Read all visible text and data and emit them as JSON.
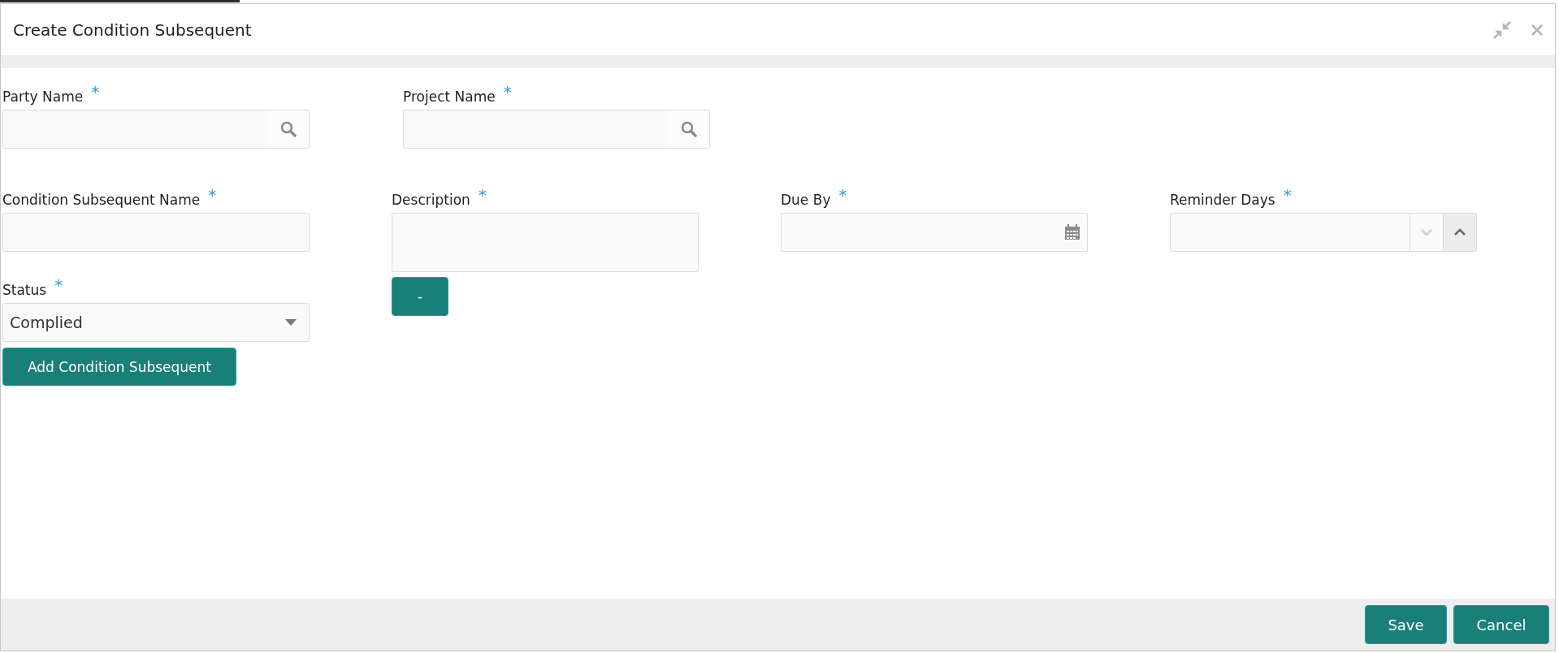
{
  "dialog": {
    "title": "Create Condition Subsequent"
  },
  "lookup_fields": [
    {
      "label": "Party Name",
      "required_mark": "*",
      "kind": "search"
    },
    {
      "label": "Project Name",
      "required_mark": "*",
      "kind": "search"
    }
  ],
  "detail_fields": [
    {
      "label": "Condition Subsequent Name",
      "required_mark": "*",
      "kind": "text"
    },
    {
      "label": "Description",
      "required_mark": "*",
      "kind": "textarea"
    },
    {
      "label": "Due By",
      "required_mark": "*",
      "kind": "date"
    },
    {
      "label": "Reminder Days",
      "required_mark": "*",
      "kind": "spinner"
    }
  ],
  "status_field": {
    "label": "Status",
    "required_mark": "*",
    "value": "Complied"
  },
  "remove_button": "-",
  "add_button": "Add Condition Subsequent",
  "footer_buttons": [
    "Save",
    "Cancel"
  ]
}
